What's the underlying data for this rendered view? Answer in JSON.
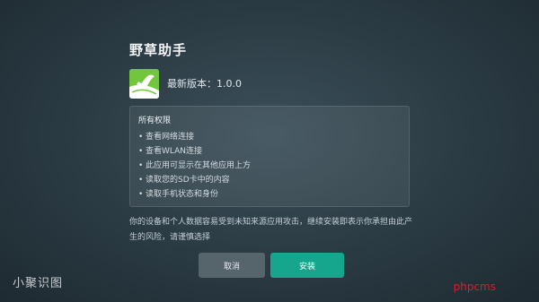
{
  "dialog": {
    "app_name": "野草助手",
    "version_text": "最新版本：1.0.0",
    "icon": "app-logo-icon",
    "permissions": {
      "title": "所有权限",
      "items": [
        "查看网络连接",
        "查看WLAN连接",
        "此应用可显示在其他应用上方",
        "读取您的SD卡中的内容",
        "读取手机状态和身份"
      ]
    },
    "warning_line1": "你的设备和个人数据容易受到未知来源应用攻击，继续安装即表示你承担由此产",
    "warning_line2": "生的风险，请谨慎选择",
    "cancel_label": "取消",
    "install_label": "安装"
  },
  "watermarks": {
    "left": "小聚识图",
    "right": "phpcms"
  },
  "colors": {
    "accent": "#16a58d",
    "cancel_bg": "#56646c",
    "background": "#2f3f48"
  }
}
